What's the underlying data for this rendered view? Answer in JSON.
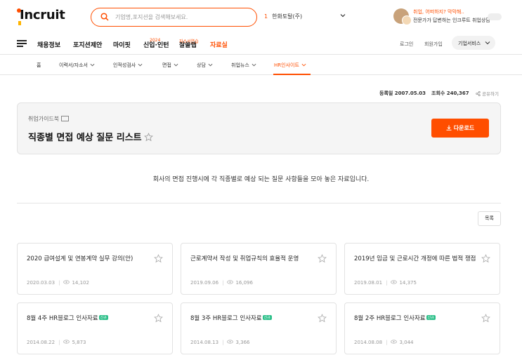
{
  "logo": {
    "text": "Incruit"
  },
  "search": {
    "placeholder": "기업명,포지션을 검색해보세요."
  },
  "ranking": {
    "number": "1",
    "company": "한화토탈(주)"
  },
  "promo": {
    "line1": "취업, 어떠하지? 막막해..",
    "line2": "전문가가 답변하는 인크루트 취업상담"
  },
  "gnb": {
    "items": [
      "채용정보",
      "포지션제안",
      "마이핏",
      "신입·인턴",
      "잘쓸랩",
      "자료실"
    ],
    "tags": {
      "intern": "2024",
      "lab": "자소서연습"
    },
    "login": "로그인",
    "signup": "회원가입",
    "biz": "기업서비스"
  },
  "lnb": {
    "home": "홈",
    "items": [
      "이력서/자소서",
      "인적성검사",
      "면접",
      "상담",
      "취업뉴스",
      "HR인사이트"
    ]
  },
  "meta": {
    "date": "등록일 2007.05.03",
    "views": "조회수 240,367",
    "share": "공유하기"
  },
  "doc": {
    "category": "취업가이드북",
    "title": "직종별 면접 예상 질문 리스트",
    "download": "다운로드",
    "description": "회사의 면접 진행시에 각 직종별로 예상 되는 질문 사항들을 모아 놓은 자료입니다."
  },
  "list_button": "목록",
  "new_badge": "신규",
  "cards": [
    {
      "title": "2020 급여설계 및 연봉계약 실무 강의(안)",
      "date": "2020.03.03",
      "views": "14,102",
      "new": false
    },
    {
      "title": "근로계약서 작성 및 취업규칙의 효율적 운영",
      "date": "2019.09.06",
      "views": "16,096",
      "new": false
    },
    {
      "title": "2019년 임금 및 근로시간 개정에 따른 법적 쟁점",
      "date": "2019.08.01",
      "views": "14,375",
      "new": false
    },
    {
      "title": "8월 4주 HR블로그 인사자료",
      "date": "2014.08.22",
      "views": "5,873",
      "new": true
    },
    {
      "title": "8월 3주 HR블로그 인사자료",
      "date": "2014.08.13",
      "views": "3,366",
      "new": true
    },
    {
      "title": "8월 2주 HR블로그 인사자료",
      "date": "2014.08.08",
      "views": "3,044",
      "new": true
    }
  ]
}
